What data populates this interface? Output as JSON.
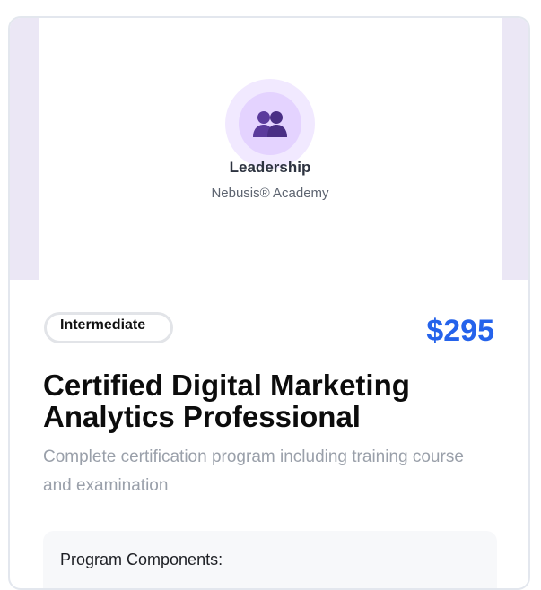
{
  "hero": {
    "category": "Leadership",
    "provider": "Nebusis® Academy",
    "icon": "people-icon",
    "ring_color": "#f1e9ff",
    "icon_color": "#5b3b9c"
  },
  "course": {
    "level": "Intermediate",
    "price": "$295",
    "price_color": "#2563eb",
    "title": "Certified Digital Marketing Analytics Professional",
    "description": "Complete certification program including training course and examination"
  },
  "components": {
    "heading": "Program Components:"
  }
}
